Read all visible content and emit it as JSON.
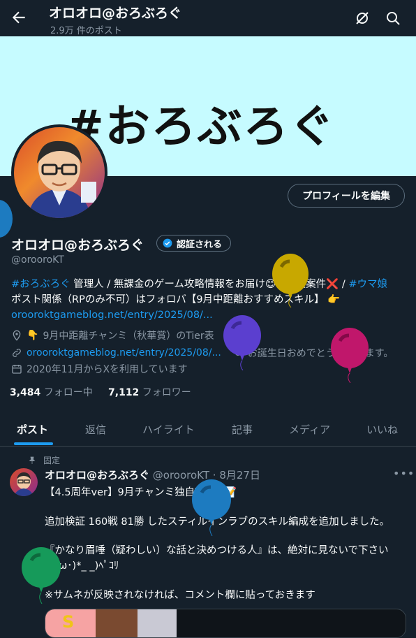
{
  "header": {
    "title": "オロオロ@おろぶろぐ",
    "post_count": "2.9万 件のポスト"
  },
  "banner": {
    "text": "#おろぶろぐ"
  },
  "profile": {
    "edit_button": "プロフィールを編集",
    "name": "オロオロ@おろぶろぐ",
    "verified_label": "認証される",
    "handle": "@orooroKT",
    "bio": {
      "tag1": "#おろぶろぐ",
      "text1": " 管理人 / 無課金のゲーム攻略情報をお届け",
      "text2": " / 企業案件",
      "text3": " / ",
      "tag2": "#ウマ娘",
      "line2": "ポスト関係（RPのみ不可）はフォロバ【9月中距離おすすめスキル】",
      "link": "oroorokt​gameblog.net/entry/2025/08/..."
    },
    "location": "9月中距離チャンミ（秋華賞）のTier表",
    "website": "oroorokt​gameblog.net/entry/2025/08/...",
    "birthday": "お誕生日おめでとうございます。",
    "joined": "2020年11月からXを利用しています",
    "following_count": "3,484",
    "following_label": "フォロー中",
    "followers_count": "7,112",
    "followers_label": "フォロワー"
  },
  "tabs": [
    "ポスト",
    "返信",
    "ハイライト",
    "記事",
    "メディア",
    "いいね"
  ],
  "post": {
    "pinned_label": "固定",
    "author_name": "オロオロ@おろぶろぐ",
    "author_meta": "@orooroKT · 8月27日",
    "line1": "【4.5周年ver】9月チャンミ独自Tier表",
    "line2": "追加検証 160戦 81勝 したスティルインラブのスキル編成を追加しました。",
    "line3": "『かなり眉唾（疑わしい）な話と決めつける人』は、絶対に見ないで下さい",
    "line4": "(*･ω･)*_ _)ﾍﾟｺﾘ",
    "line5": "※サムネが反映されなければ、コメント欄に貼っておきます",
    "card_letter": "S"
  },
  "colors": {
    "accent": "#1d9bf0",
    "background": "#15202b",
    "banner": "#c6fbff"
  }
}
